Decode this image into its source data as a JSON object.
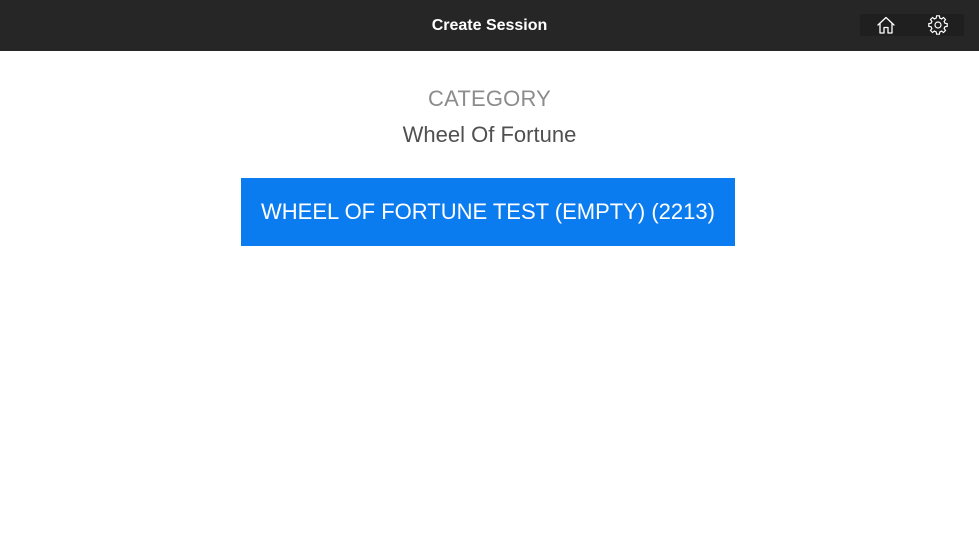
{
  "header": {
    "title": "Create Session",
    "icons": {
      "home": "home-icon",
      "settings": "gear-icon"
    },
    "background_color": "#262626"
  },
  "category": {
    "label": "CATEGORY",
    "name": "Wheel Of Fortune"
  },
  "sessions": [
    {
      "label": "WHEEL OF FORTUNE TEST (EMPTY) (2213)",
      "color": "#0b7cf0"
    }
  ]
}
